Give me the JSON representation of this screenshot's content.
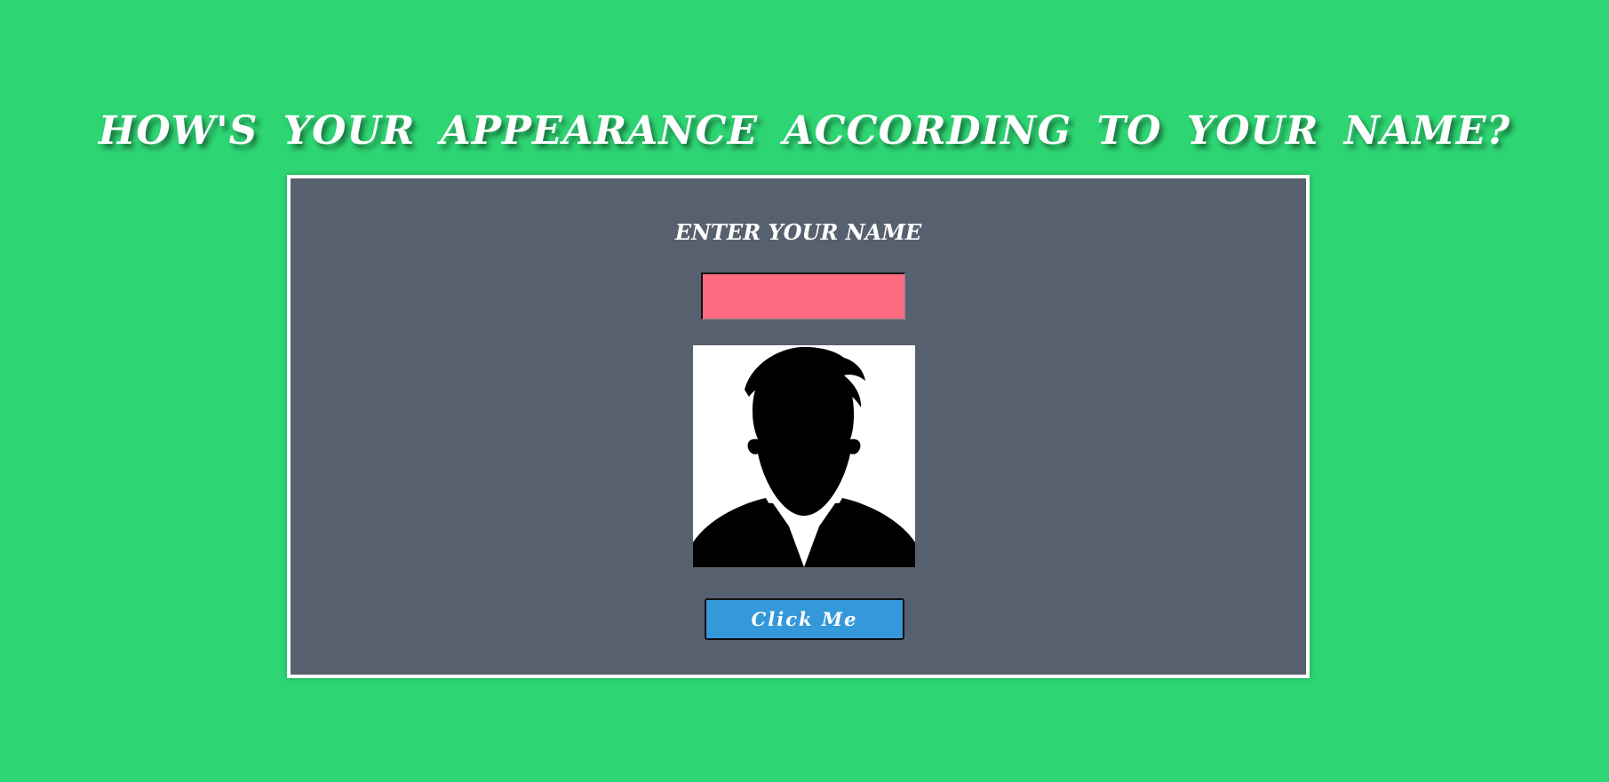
{
  "page": {
    "title": "HOW'S YOUR APPEARANCE ACCORDING TO YOUR NAME?"
  },
  "form": {
    "label": "ENTER YOUR NAME",
    "name_value": "",
    "button_label": "Click Me"
  },
  "avatar": {
    "icon": "person-silhouette-icon"
  },
  "colors": {
    "background": "#2ed573",
    "card": "#57606f",
    "card_border": "#ffffff",
    "input": "#ff6b81",
    "button": "#3498db",
    "text": "#ffffff"
  }
}
